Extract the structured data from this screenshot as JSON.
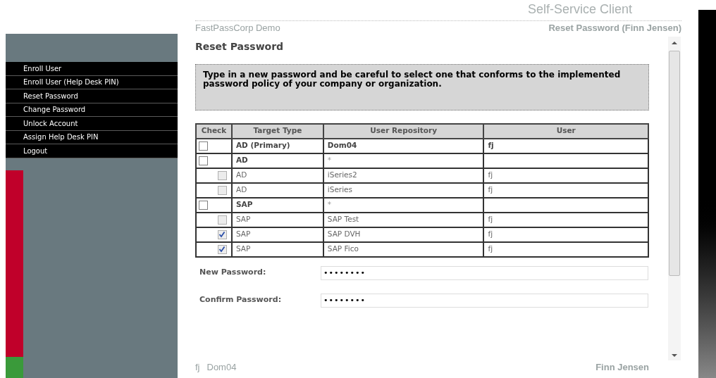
{
  "header": {
    "title": "Self-Service Client"
  },
  "sidebar": {
    "items": [
      {
        "label": "Enroll User"
      },
      {
        "label": "Enroll User (Help Desk PIN)"
      },
      {
        "label": "Reset Password"
      },
      {
        "label": "Change Password"
      },
      {
        "label": "Unlock Account"
      },
      {
        "label": "Assign Help Desk PIN"
      },
      {
        "label": "Logout"
      }
    ]
  },
  "breadcrumb": {
    "left": "FastPassCorp Demo",
    "right": "Reset Password (Finn Jensen)"
  },
  "page_title": "Reset Password",
  "notice": "Type in a new password and be careful to select one that conforms to the implemented password policy of your company or organization.",
  "table": {
    "columns": [
      "Check",
      "Target Type",
      "User Repository",
      "User"
    ],
    "rows": [
      {
        "kind": "primary",
        "checked": false,
        "target_type": "AD (Primary)",
        "repository": "Dom04",
        "user": "fj"
      },
      {
        "kind": "group",
        "checked": false,
        "target_type": "AD",
        "repository": "*"
      },
      {
        "kind": "member",
        "checked": false,
        "target_type": "AD",
        "repository": "iSeries2",
        "user": "fj"
      },
      {
        "kind": "member",
        "checked": false,
        "target_type": "AD",
        "repository": "iSeries",
        "user": "fj"
      },
      {
        "kind": "group",
        "checked": false,
        "target_type": "SAP",
        "repository": "*"
      },
      {
        "kind": "member",
        "checked": false,
        "target_type": "SAP",
        "repository": "SAP Test",
        "user": "fj"
      },
      {
        "kind": "member",
        "checked": true,
        "target_type": "SAP",
        "repository": "SAP DVH",
        "user": "fj"
      },
      {
        "kind": "member",
        "checked": true,
        "target_type": "SAP",
        "repository": "SAP Fico",
        "user": "fj"
      }
    ]
  },
  "fields": [
    {
      "label": "New Password:",
      "value": "••••••••"
    },
    {
      "label": "Confirm Password:",
      "value": "••••••••"
    }
  ],
  "footer": {
    "user_id": "fj",
    "domain": "Dom04",
    "user_name": "Finn Jensen"
  }
}
